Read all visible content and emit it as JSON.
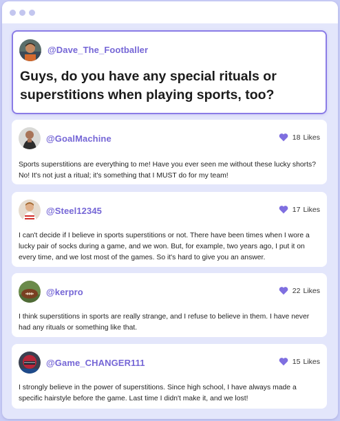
{
  "window": {
    "controls": [
      "dot-1",
      "dot-2",
      "dot-3"
    ]
  },
  "post": {
    "username": "@Dave_The_Footballer",
    "question": "Guys, do you have any special rituals or superstitions when playing sports, too?"
  },
  "likes_label": "Likes",
  "replies": [
    {
      "username": "@GoalMachine",
      "likes": "18",
      "likes_label": "Likes",
      "text": "Sports superstitions are everything to me! Have you ever seen me without these lucky shorts? No! It's not just a ritual; it's something that I MUST do for my team!"
    },
    {
      "username": "@Steel12345",
      "likes": "17",
      "likes_label": "Likes",
      "text": "I can't decide if I believe in sports superstitions or not. There have been times when I wore a lucky pair of socks during a game, and we won. But, for example, two years ago, I put it on every time, and we lost most of the games. So it's hard to give you an answer."
    },
    {
      "username": "@kerpro",
      "likes": "22",
      "likes_label": "Likes",
      "text": "I think superstitions in sports are really strange, and I refuse to believe in them. I have never had any rituals or something like that."
    },
    {
      "username": "@Game_CHANGER111",
      "likes": "15",
      "likes_label": "Likes",
      "text": "I strongly believe in the power of superstitions. Since high school, I have always made a specific hairstyle before the game. Last time I didn't make it, and we lost!"
    }
  ],
  "colors": {
    "accent": "#7566d6",
    "heart": "#7f6fe0",
    "border": "#8a7ce6",
    "background": "#e3e6fb"
  }
}
